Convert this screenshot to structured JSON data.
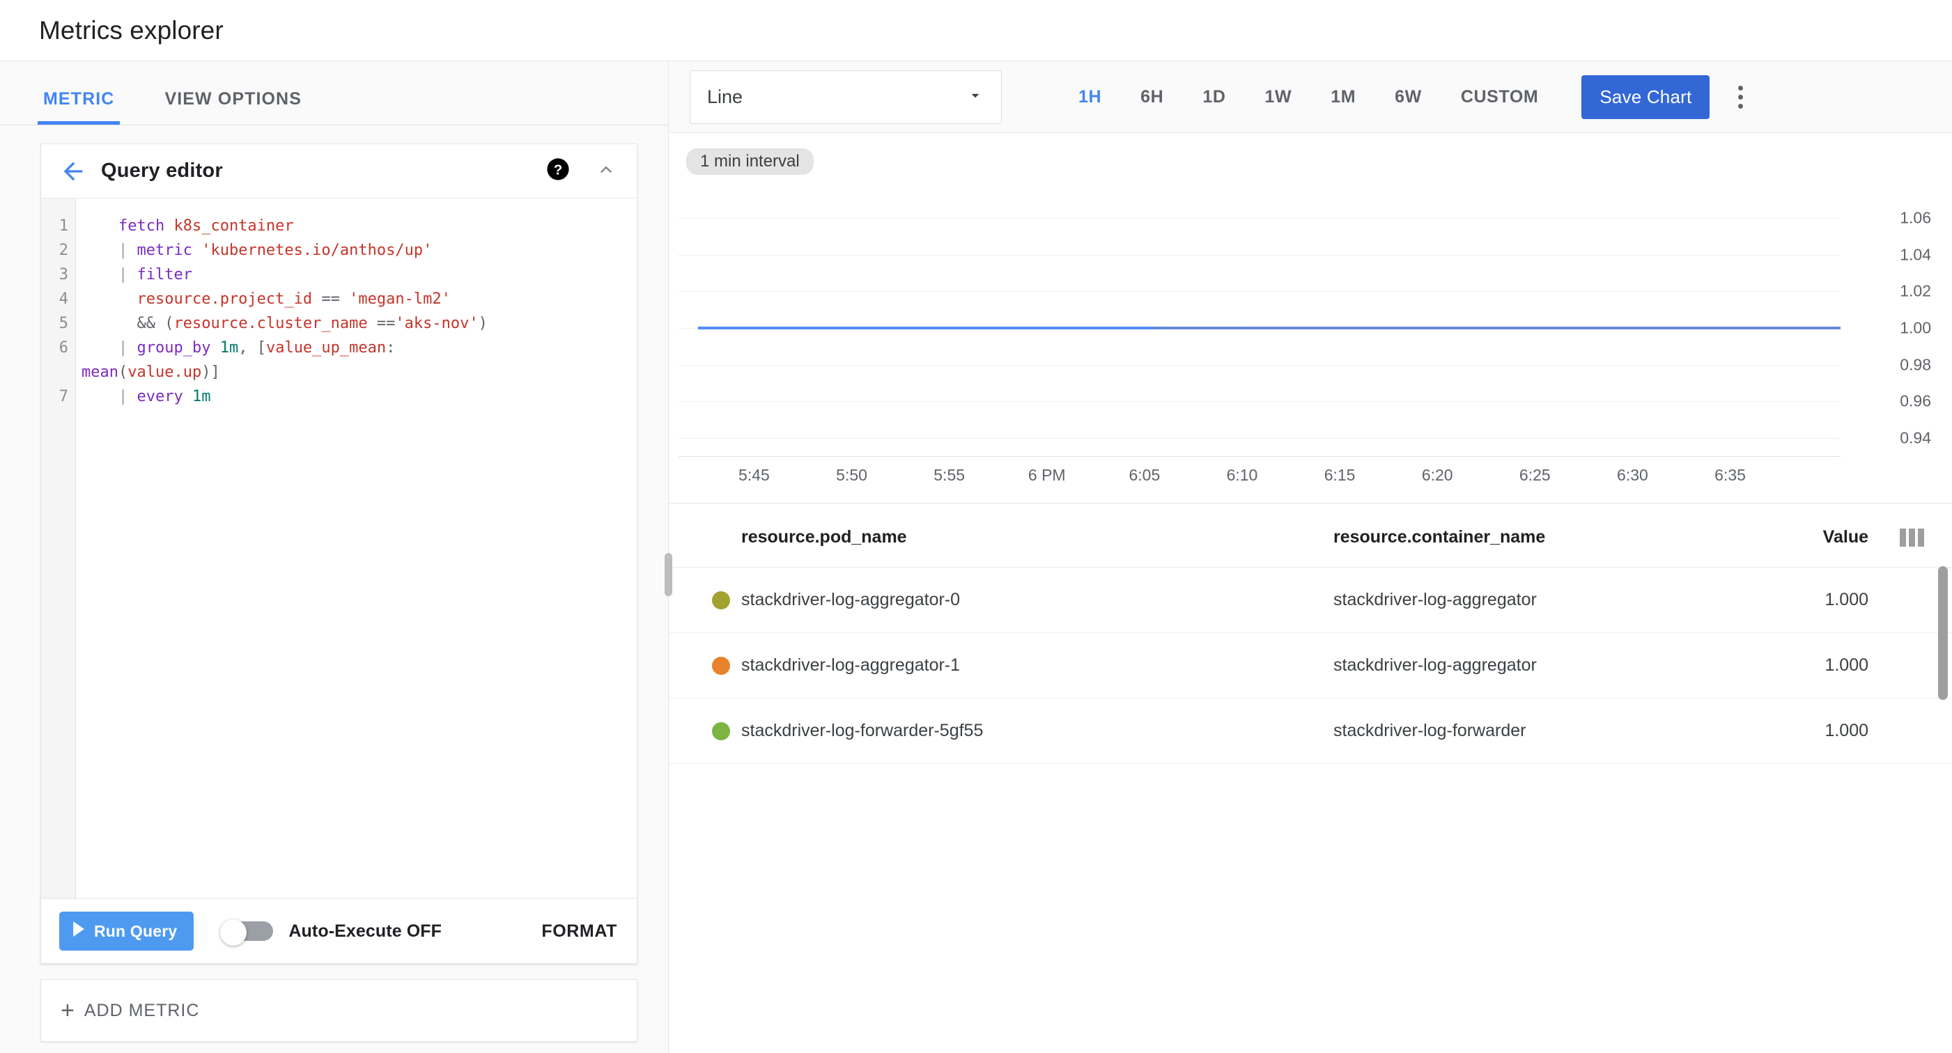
{
  "app": {
    "title": "Metrics explorer"
  },
  "left": {
    "tabs": [
      {
        "label": "METRIC",
        "active": true
      },
      {
        "label": "VIEW OPTIONS",
        "active": false
      }
    ],
    "query_editor": {
      "title": "Query editor",
      "back_icon": "back-arrow-icon",
      "help_icon": "help-circle-icon",
      "collapse_icon": "chevron-up-icon",
      "line_numbers": [
        "1",
        "2",
        "3",
        "4",
        "5",
        "6",
        "7"
      ],
      "code_lines": [
        "fetch k8s_container",
        "| metric 'kubernetes.io/anthos/up'",
        "| filter",
        "resource.project_id == 'megan-lm2'",
        "&& (resource.cluster_name =='aks-nov')",
        "| group_by 1m, [value_up_mean: mean(value.up)]",
        "| every 1m"
      ]
    },
    "run_bar": {
      "run_label": "Run Query",
      "run_icon": "play-icon",
      "auto_execute_label": "Auto-Execute OFF",
      "auto_execute_on": false,
      "format_label": "FORMAT"
    },
    "add_metric": {
      "label": "ADD METRIC",
      "icon": "plus-icon"
    }
  },
  "right": {
    "toolbar": {
      "chart_type": "Line",
      "chart_type_icon": "chevron-down-icon",
      "ranges": [
        {
          "label": "1H",
          "active": true
        },
        {
          "label": "6H",
          "active": false
        },
        {
          "label": "1D",
          "active": false
        },
        {
          "label": "1W",
          "active": false
        },
        {
          "label": "1M",
          "active": false
        },
        {
          "label": "6W",
          "active": false
        },
        {
          "label": "CUSTOM",
          "active": false
        }
      ],
      "save_chart_label": "Save Chart",
      "more_icon": "more-vert-icon"
    },
    "chart": {
      "interval_chip": "1 min interval"
    },
    "table": {
      "headers": [
        "resource.pod_name",
        "resource.container_name",
        "Value"
      ],
      "column_picker_icon": "columns-icon",
      "rows": [
        {
          "color": "#a3a12f",
          "pod_name": "stackdriver-log-aggregator-0",
          "container_name": "stackdriver-log-aggregator",
          "value": "1.000"
        },
        {
          "color": "#e8822c",
          "pod_name": "stackdriver-log-aggregator-1",
          "container_name": "stackdriver-log-aggregator",
          "value": "1.000"
        },
        {
          "color": "#7cb342",
          "pod_name": "stackdriver-log-forwarder-5gf55",
          "container_name": "stackdriver-log-forwarder",
          "value": "1.000"
        }
      ]
    }
  },
  "colors": {
    "accent_blue": "#4285f4",
    "save_button_blue": "#3367d6",
    "run_button_blue": "#4e9af1",
    "series_line": "#5b7fd4"
  },
  "chart_data": {
    "type": "line",
    "title": "",
    "xlabel": "",
    "ylabel": "",
    "ylim": [
      0.93,
      1.07
    ],
    "yticks": [
      1.06,
      1.04,
      1.02,
      1.0,
      0.98,
      0.96,
      0.94
    ],
    "ytick_labels": [
      "1.06",
      "1.04",
      "1.02",
      "1.00",
      "0.98",
      "0.96",
      "0.94"
    ],
    "xtick_labels": [
      "5:45",
      "5:50",
      "5:55",
      "6 PM",
      "6:05",
      "6:10",
      "6:15",
      "6:20",
      "6:25",
      "6:30",
      "6:35"
    ],
    "grid": true,
    "legend_position": "table-below",
    "interval": "1 min",
    "series": [
      {
        "name": "stackdriver-log-aggregator-0",
        "color": "#a3a12f",
        "x": [
          "5:45",
          "5:50",
          "5:55",
          "6 PM",
          "6:05",
          "6:10",
          "6:15",
          "6:20",
          "6:25",
          "6:30",
          "6:35"
        ],
        "values": [
          1.0,
          1.0,
          1.0,
          1.0,
          1.0,
          1.0,
          1.0,
          1.0,
          1.0,
          1.0,
          1.0
        ]
      },
      {
        "name": "stackdriver-log-aggregator-1",
        "color": "#e8822c",
        "x": [
          "5:45",
          "5:50",
          "5:55",
          "6 PM",
          "6:05",
          "6:10",
          "6:15",
          "6:20",
          "6:25",
          "6:30",
          "6:35"
        ],
        "values": [
          1.0,
          1.0,
          1.0,
          1.0,
          1.0,
          1.0,
          1.0,
          1.0,
          1.0,
          1.0,
          1.0
        ]
      },
      {
        "name": "stackdriver-log-forwarder-5gf55",
        "color": "#7cb342",
        "x": [
          "5:45",
          "5:50",
          "5:55",
          "6 PM",
          "6:05",
          "6:10",
          "6:15",
          "6:20",
          "6:25",
          "6:30",
          "6:35"
        ],
        "values": [
          1.0,
          1.0,
          1.0,
          1.0,
          1.0,
          1.0,
          1.0,
          1.0,
          1.0,
          1.0,
          1.0
        ]
      }
    ]
  }
}
